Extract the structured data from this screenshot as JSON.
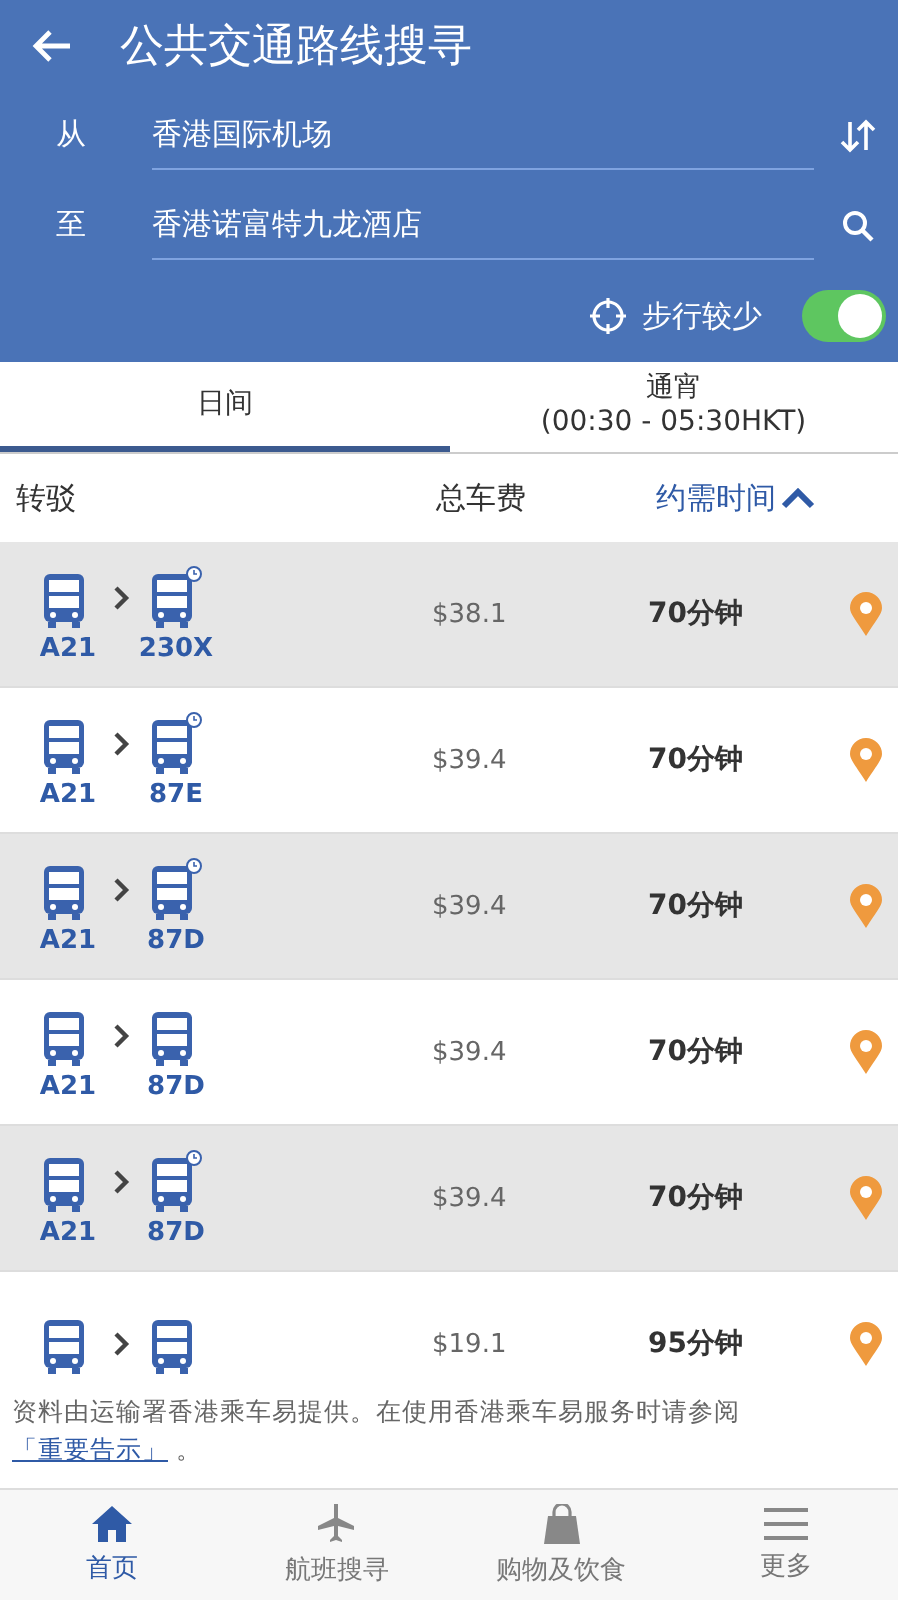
{
  "header": {
    "title": "公共交通路线搜寻",
    "from": {
      "label": "从",
      "value": "香港国际机场"
    },
    "to": {
      "label": "至",
      "value": "香港诺富特九龙酒店"
    },
    "walk_less": {
      "label": "步行较少",
      "on": true
    }
  },
  "tabs": [
    {
      "label": "日间",
      "selected": true
    },
    {
      "label": "通宵",
      "sub": "(00:30 - 05:30HKT)",
      "selected": false
    }
  ],
  "columns": [
    {
      "label": "转驳",
      "sorted": false
    },
    {
      "label": "总车费",
      "sorted": false
    },
    {
      "label": "约需时间",
      "sorted": true
    }
  ],
  "routes": [
    {
      "legs": [
        {
          "route": "A21",
          "timetable": false
        },
        {
          "route": "230X",
          "timetable": true
        }
      ],
      "fare": "$38.1",
      "time": "70分钟"
    },
    {
      "legs": [
        {
          "route": "A21",
          "timetable": false
        },
        {
          "route": "87E",
          "timetable": true
        }
      ],
      "fare": "$39.4",
      "time": "70分钟"
    },
    {
      "legs": [
        {
          "route": "A21",
          "timetable": false
        },
        {
          "route": "87D",
          "timetable": true
        }
      ],
      "fare": "$39.4",
      "time": "70分钟"
    },
    {
      "legs": [
        {
          "route": "A21",
          "timetable": false
        },
        {
          "route": "87D",
          "timetable": false
        }
      ],
      "fare": "$39.4",
      "time": "70分钟"
    },
    {
      "legs": [
        {
          "route": "A21",
          "timetable": false
        },
        {
          "route": "87D",
          "timetable": true
        }
      ],
      "fare": "$39.4",
      "time": "70分钟"
    },
    {
      "legs": [
        {
          "timetable": false
        },
        {
          "timetable": false
        }
      ],
      "fare": "$19.1",
      "time": "95分钟"
    }
  ],
  "note": {
    "text": "资料由运输署香港乘车易提供。在使用香港乘车易服务时请参阅",
    "link": "「重要告示」",
    "end": " 。"
  },
  "nav": [
    {
      "label": "首页",
      "kind": "home",
      "selected": true
    },
    {
      "label": "航班搜寻",
      "kind": "flight",
      "selected": false
    },
    {
      "label": "购物及饮食",
      "kind": "shop",
      "selected": false
    },
    {
      "label": "更多",
      "kind": "menu",
      "selected": false
    }
  ]
}
